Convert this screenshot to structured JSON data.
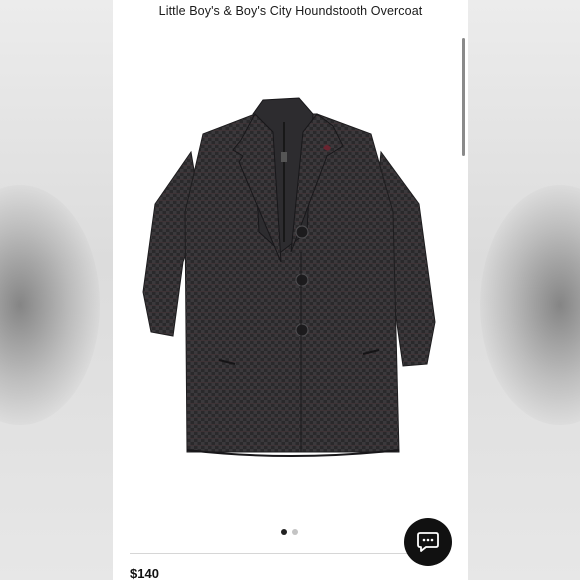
{
  "product": {
    "title": "Little Boy's & Boy's City Houndstooth Overcoat",
    "price": "$140",
    "image_icon": "houndstooth-overcoat-image"
  },
  "carousel": {
    "total_dots": 2,
    "active_index": 0
  },
  "chat": {
    "icon": "chat-bubble-icon"
  },
  "colors": {
    "coat": "#2b2a2c",
    "coat_check": "#5a3a3f",
    "chat_button": "#111111"
  }
}
